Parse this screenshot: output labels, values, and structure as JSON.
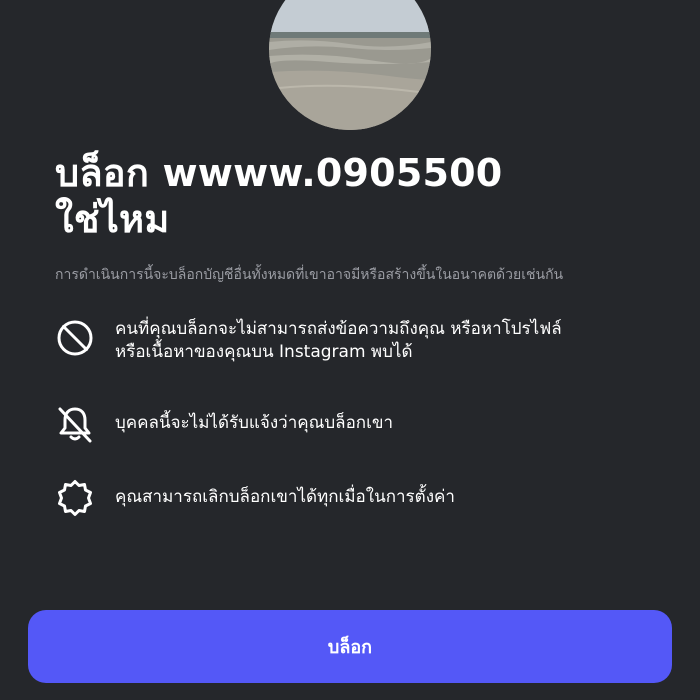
{
  "profile": {
    "avatar_alt": "beach photo"
  },
  "dialog": {
    "title_line1": "บล็อก wwww.0905500",
    "title_line2": "ใช่ไหม",
    "subtitle": "การดำเนินการนี้จะบล็อกบัญชีอื่นทั้งหมดที่เขาอาจมีหรือสร้างขึ้นในอนาคตด้วยเช่นกัน",
    "items": [
      {
        "icon": "blocked-circle-icon",
        "text_line1": "คนที่คุณบล็อกจะไม่สามารถส่งข้อความถึงคุณ หรือหาโปรไฟล์",
        "text_line2": "หรือเนื้อหาของคุณบน Instagram พบได้"
      },
      {
        "icon": "bell-off-icon",
        "text_line1": "บุคคลนี้จะไม่ได้รับแจ้งว่าคุณบล็อกเขา"
      },
      {
        "icon": "gear-icon",
        "text_line1": "คุณสามารถเลิกบล็อกเขาได้ทุกเมื่อในการตั้งค่า"
      }
    ],
    "block_button_label": "บล็อก"
  },
  "colors": {
    "background": "#25272b",
    "accent": "#5458f7",
    "secondary_text": "#9a9ca3"
  }
}
